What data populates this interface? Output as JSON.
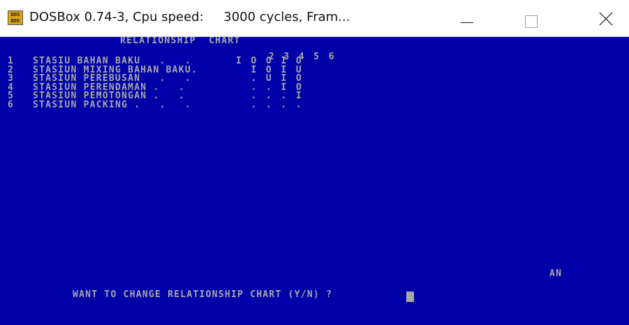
{
  "window": {
    "title": "DOSBox 0.74-3, Cpu speed:     3000 cycles, Fram...",
    "icon_text_top": "DOS",
    "icon_text_bottom": "BOX"
  },
  "controls": {
    "minimize": "minimize-icon",
    "maximize": "maximize-icon",
    "close": "close-icon"
  },
  "terminal": {
    "colors": {
      "background": "#0000a8",
      "text": "#a8a8a8"
    },
    "chart_title": "RELATIONSHIP  CHART",
    "column_numbers": [
      "2",
      "3",
      "4",
      "5",
      "6"
    ],
    "rows": [
      {
        "num": "1",
        "name": "STASIU BAHAN BAKU   .   .",
        "relations": [
          "I",
          "O",
          "O",
          "I",
          "O"
        ]
      },
      {
        "num": "2",
        "name": "STASIUN MIXING BAHAN BAKU.",
        "relations": [
          "",
          "I",
          "O",
          "I",
          "U"
        ]
      },
      {
        "num": "3",
        "name": "STASIUN PEREBUSAN   .   .",
        "relations": [
          "",
          ".",
          "U",
          "I",
          "O"
        ]
      },
      {
        "num": "4",
        "name": "STASIUN PERENDAMAN .   .",
        "relations": [
          "",
          ".",
          ".",
          "I",
          "O"
        ]
      },
      {
        "num": "5",
        "name": "STASIUN PEMOTONGAN .   .",
        "relations": [
          "",
          ".",
          ".",
          ".",
          "I"
        ]
      },
      {
        "num": "6",
        "name": "STASIUN PACKING .   .   .",
        "relations": [
          "",
          ".",
          ".",
          ".",
          "."
        ]
      }
    ],
    "status_text": "AN",
    "prompt": "WANT TO CHANGE RELATIONSHIP CHART (Y/N) ?"
  }
}
